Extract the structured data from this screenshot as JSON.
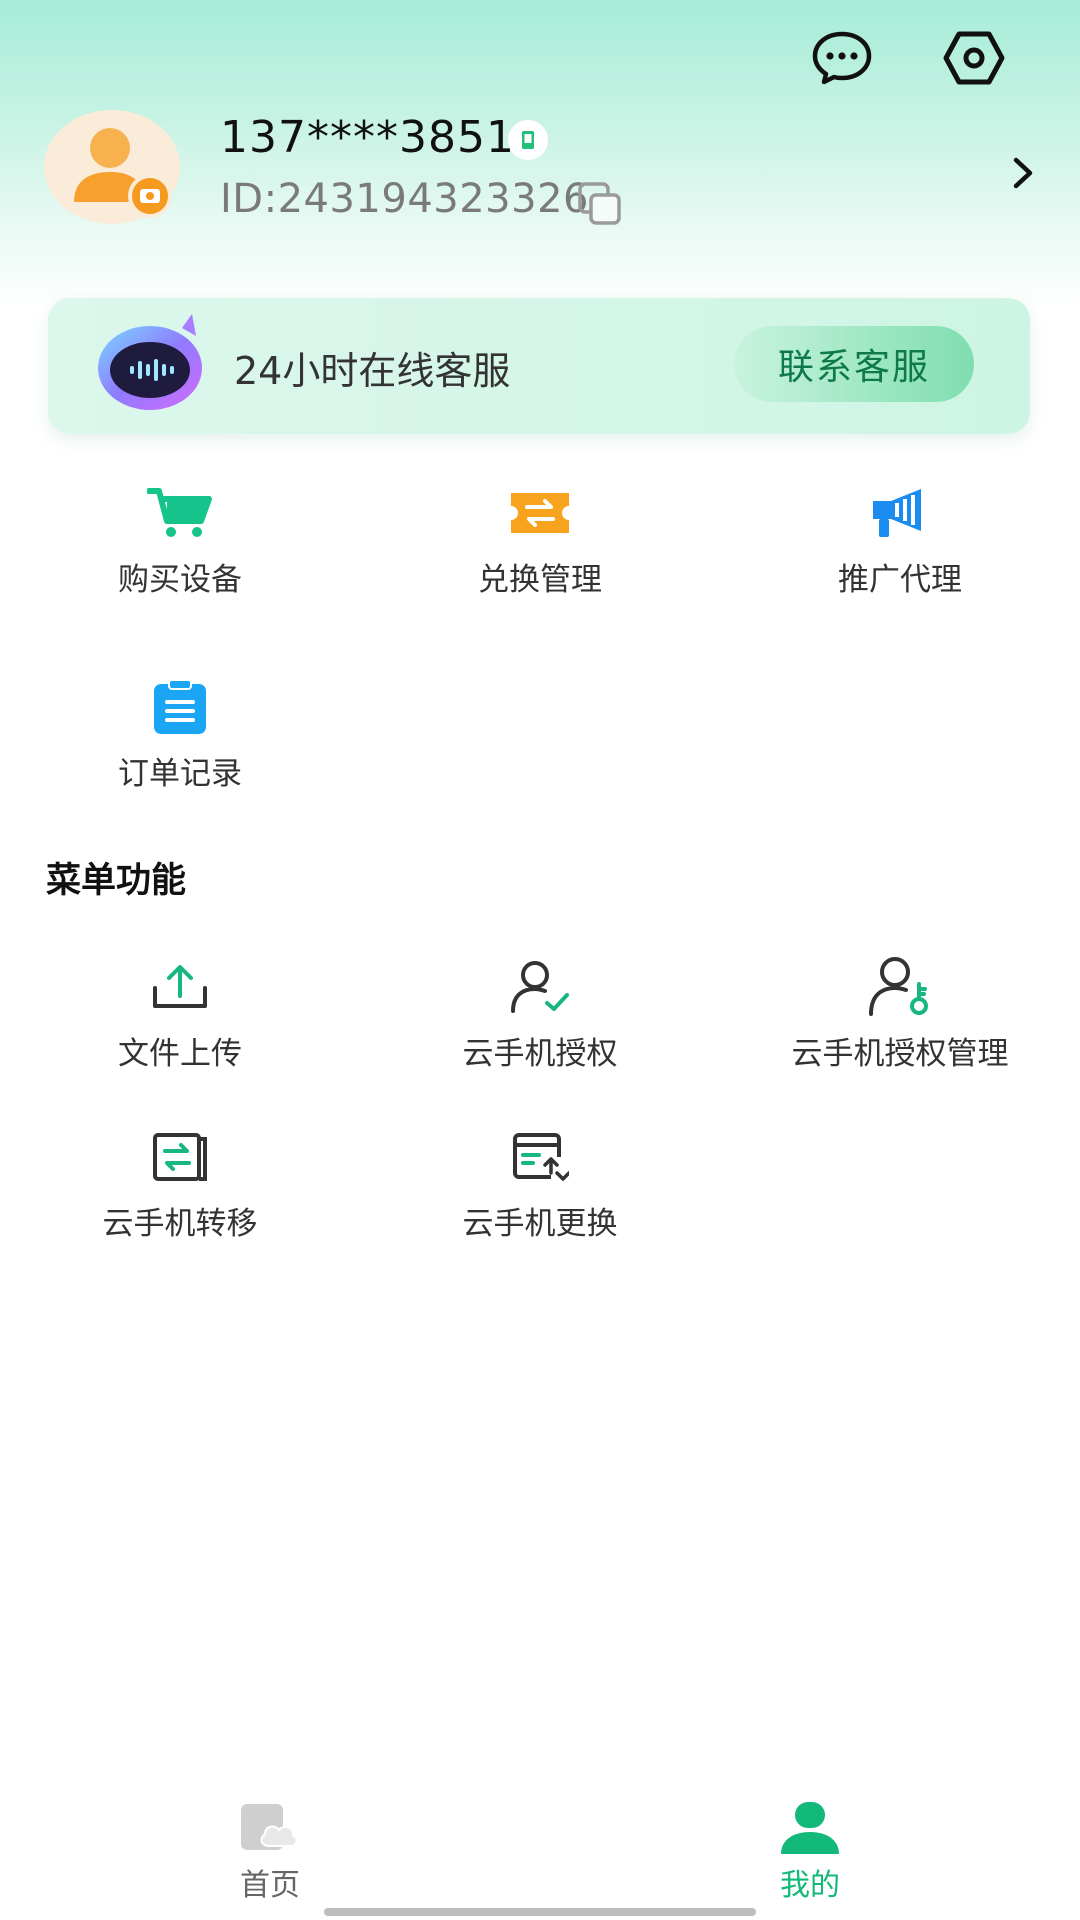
{
  "header": {
    "phone": "137****3851",
    "id_text": "ID:243194323326",
    "top_icons": [
      "chat-bubble-icon",
      "settings-hexagon-icon"
    ]
  },
  "service": {
    "text": "24小时在线客服",
    "button": "联系客服"
  },
  "shortcuts": [
    {
      "label": "购买设备",
      "icon": "shopping-cart-icon"
    },
    {
      "label": "兑换管理",
      "icon": "exchange-ticket-icon"
    },
    {
      "label": "推广代理",
      "icon": "megaphone-icon"
    },
    {
      "label": "订单记录",
      "icon": "clipboard-icon"
    }
  ],
  "menu": {
    "title": "菜单功能",
    "items": [
      {
        "label": "文件上传",
        "icon": "upload-icon"
      },
      {
        "label": "云手机授权",
        "icon": "user-check-icon"
      },
      {
        "label": "云手机授权管理",
        "icon": "user-key-icon"
      },
      {
        "label": "云手机转移",
        "icon": "transfer-icon"
      },
      {
        "label": "云手机更换",
        "icon": "swap-card-icon"
      }
    ]
  },
  "tabbar": {
    "tabs": [
      {
        "label": "首页",
        "active": false,
        "icon": "home-cloud-icon"
      },
      {
        "label": "我的",
        "active": true,
        "icon": "profile-icon"
      }
    ]
  },
  "colors": {
    "accent": "#12b97a",
    "accent_dark": "#0e7a4b",
    "inactive": "#8a8a8a"
  }
}
